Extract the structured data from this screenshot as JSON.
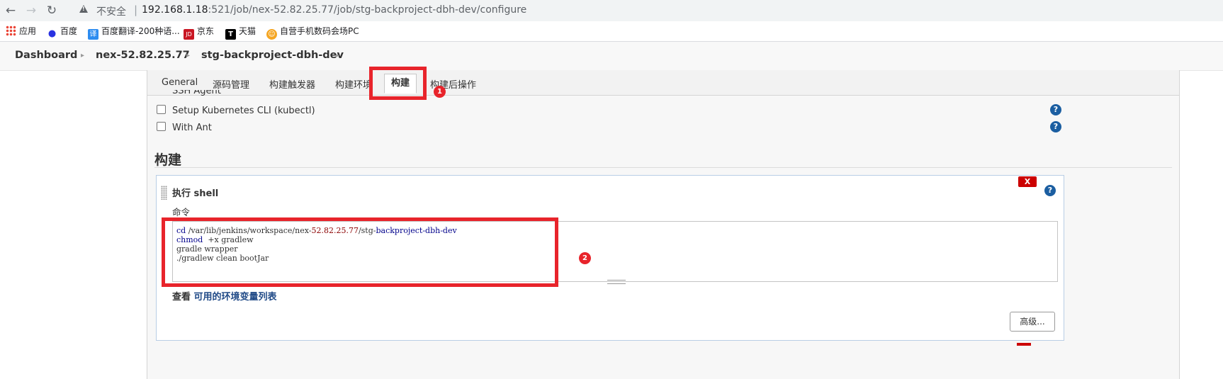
{
  "browser": {
    "insecure_label": "不安全",
    "url_host": "192.168.1.18",
    "url_rest": ":521/job/nex-52.82.25.77/job/stg-backproject-dbh-dev/configure",
    "bookmarks": [
      {
        "label": "应用",
        "icon": "apps-grid-icon"
      },
      {
        "label": "百度",
        "icon": "baidu-paw-icon"
      },
      {
        "label": "百度翻译-200种语...",
        "icon": "translate-icon",
        "icon_text": "译"
      },
      {
        "label": "京东",
        "icon": "jd-icon",
        "icon_text": "JD"
      },
      {
        "label": "天猫",
        "icon": "tmall-icon",
        "icon_text": "T"
      },
      {
        "label": "自营手机数码会场PC",
        "icon": "smiley-icon"
      }
    ]
  },
  "breadcrumb": {
    "items": [
      "Dashboard",
      "nex-52.82.25.77",
      "stg-backproject-dbh-dev"
    ]
  },
  "tabs": [
    "General",
    "源码管理",
    "构建触发器",
    "构建环境",
    "构建",
    "构建后操作"
  ],
  "active_tab": "构建",
  "build_env": {
    "cut_off_option": "SSH Agent",
    "options": [
      {
        "label": "Setup Kubernetes CLI (kubectl)",
        "checked": false
      },
      {
        "label": "With Ant",
        "checked": false
      }
    ]
  },
  "section_title": "构建",
  "build_step": {
    "title": "执行 shell",
    "delete_label": "X",
    "command_label": "命令",
    "command_lines": [
      "cd /var/lib/jenkins/workspace/nex-52.82.25.77/stg-backproject-dbh-dev",
      "chmod  +x gradlew",
      "gradle wrapper",
      "./gradlew clean bootJar"
    ],
    "env_prefix": "查看 ",
    "env_link": "可用的环境变量列表",
    "advanced_label": "高级..."
  },
  "help_label": "?",
  "annotations": [
    "1",
    "2"
  ],
  "colors": {
    "annotation_red": "#e8242b",
    "help_blue": "#1b5ea1",
    "link_blue": "#204a87",
    "delete_red": "#cc0000"
  }
}
